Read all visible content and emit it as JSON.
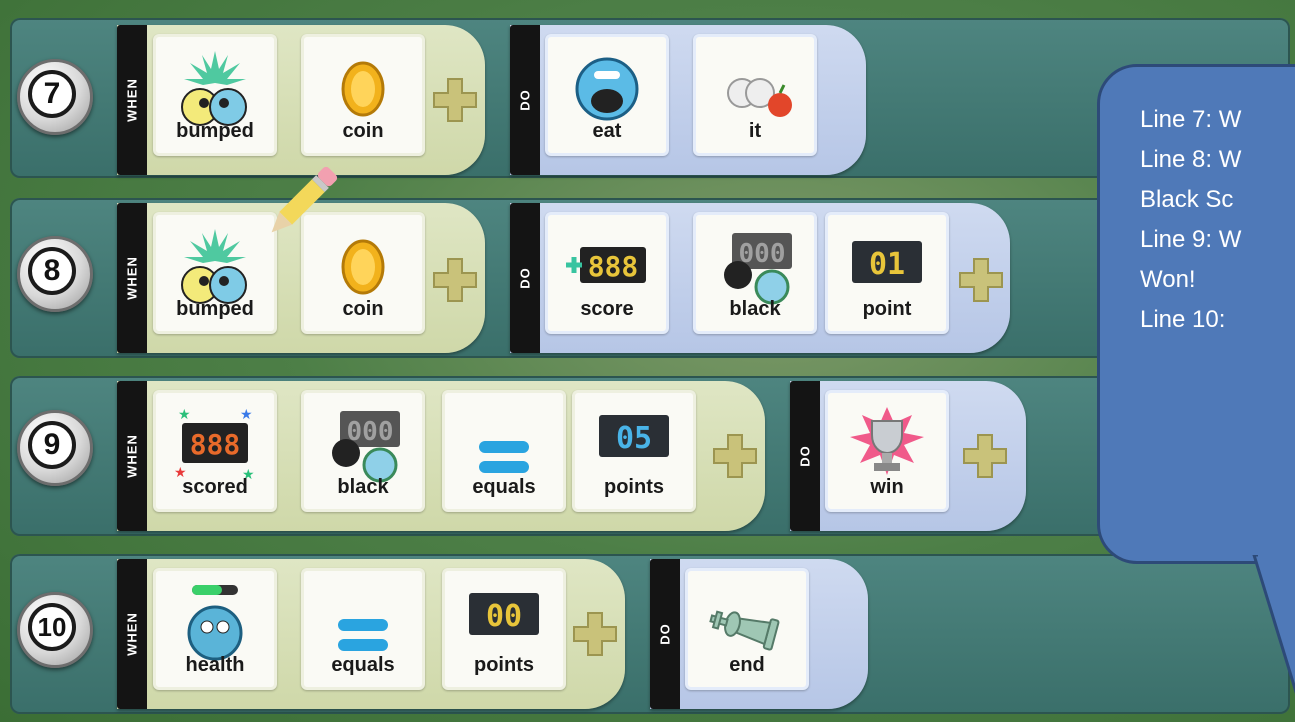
{
  "rows": [
    {
      "number": "7",
      "when_label": "WHEN",
      "do_label": "DO",
      "when_tiles": [
        {
          "label": "bumped",
          "icon": "bumped-icon"
        },
        {
          "label": "coin",
          "icon": "coin-icon"
        }
      ],
      "do_tiles": [
        {
          "label": "eat",
          "icon": "eat-icon"
        },
        {
          "label": "it",
          "icon": "it-icon"
        }
      ]
    },
    {
      "number": "8",
      "when_label": "WHEN",
      "do_label": "DO",
      "when_tiles": [
        {
          "label": "bumped",
          "icon": "bumped-icon"
        },
        {
          "label": "coin",
          "icon": "coin-icon"
        }
      ],
      "do_tiles": [
        {
          "label": "score",
          "icon": "score-icon",
          "digits": "888"
        },
        {
          "label": "black",
          "icon": "black-score-icon",
          "digits": "000"
        },
        {
          "label": "point",
          "icon": "point-icon",
          "digits": "01"
        }
      ]
    },
    {
      "number": "9",
      "when_label": "WHEN",
      "do_label": "DO",
      "when_tiles": [
        {
          "label": "scored",
          "icon": "scored-icon",
          "digits": "888"
        },
        {
          "label": "black",
          "icon": "black-score-icon",
          "digits": "000"
        },
        {
          "label": "equals",
          "icon": "equals-icon"
        },
        {
          "label": "points",
          "icon": "points-icon",
          "digits": "05"
        }
      ],
      "do_tiles": [
        {
          "label": "win",
          "icon": "trophy-icon"
        }
      ]
    },
    {
      "number": "10",
      "when_label": "WHEN",
      "do_label": "DO",
      "when_tiles": [
        {
          "label": "health",
          "icon": "health-icon"
        },
        {
          "label": "equals",
          "icon": "equals-icon"
        },
        {
          "label": "points",
          "icon": "points-icon",
          "digits": "00"
        }
      ],
      "do_tiles": [
        {
          "label": "end",
          "icon": "chess-king-icon"
        }
      ]
    }
  ],
  "note_bubble": {
    "lines": [
      "Line 7: W",
      "Line 8: W",
      "Black Sc",
      "Line 9: W",
      "Won!",
      "Line 10:"
    ]
  },
  "colors": {
    "when_panel": "#dfe6c4",
    "do_panel": "#cfdaf0",
    "row_bar": "#4e8580",
    "bubble": "#4f79b8",
    "plus": "#c9c27a"
  }
}
